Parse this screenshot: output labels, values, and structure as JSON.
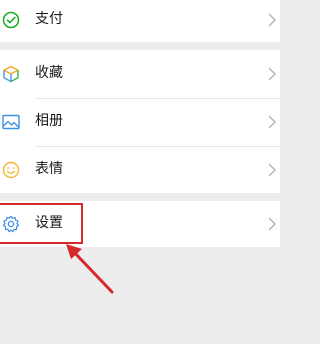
{
  "menu": {
    "pay": {
      "label": "支付",
      "icon": "wechat-pay-icon",
      "icon_color": "#1aad19"
    },
    "favorites": {
      "label": "收藏",
      "icon": "cube-icon",
      "icon_colors": [
        "#f5a623",
        "#3d9bf0",
        "#39b54a"
      ]
    },
    "album": {
      "label": "相册",
      "icon": "picture-icon",
      "icon_color": "#3d8ee6"
    },
    "stickers": {
      "label": "表情",
      "icon": "smiley-icon",
      "icon_color": "#f2b632"
    },
    "settings": {
      "label": "设置",
      "icon": "gear-icon",
      "icon_color": "#3d8ee6"
    }
  },
  "annotation": {
    "highlight_color": "#d42a2a",
    "arrow_color": "#d42a2a",
    "target": "settings"
  },
  "colors": {
    "background": "#ededed",
    "row_background": "#ffffff",
    "chevron": "#b2b2b2",
    "text": "#1a1a1a"
  }
}
